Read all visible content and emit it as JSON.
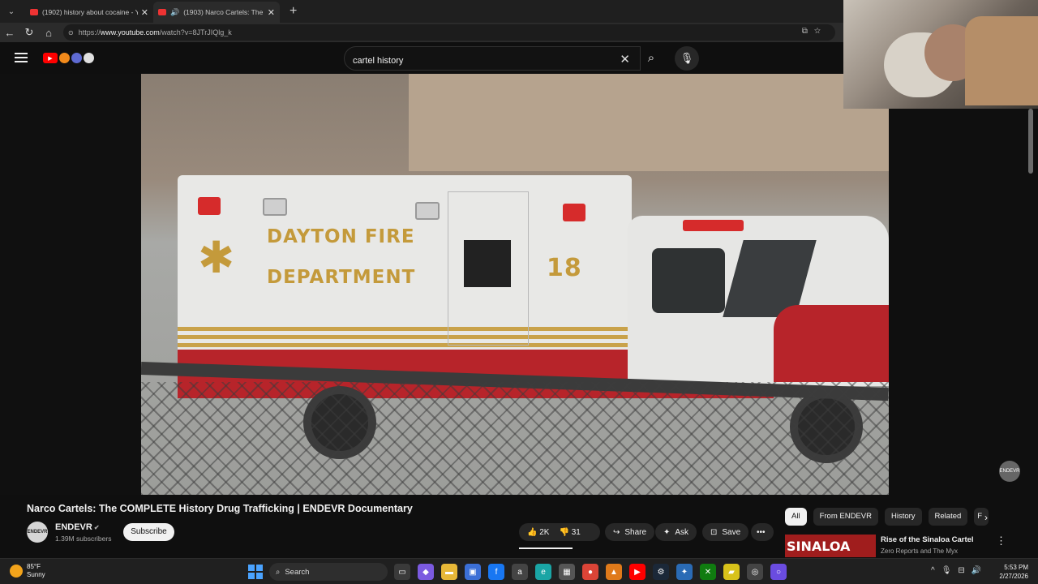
{
  "browser": {
    "tabs": [
      {
        "title": "(1902) history about cocaine - Yo",
        "active": false
      },
      {
        "title": "(1903) Narco Cartels: The CO",
        "active": true
      }
    ],
    "url_prefix": "https://",
    "url_host": "www.youtube.com",
    "url_path": "/watch?v=8JTrJIQlg_k"
  },
  "youtube": {
    "search_value": "cartel history",
    "video": {
      "title": "Narco Cartels: The COMPLETE History Drug Trafficking | ENDEVR Documentary",
      "channel_name": "ENDEVR",
      "channel_avatar_text": "ENDEVR",
      "subscribers": "1.39M subscribers",
      "subscribe_label": "Subscribe",
      "likes": "2K",
      "dislikes": "31",
      "share_label": "Share",
      "ask_label": "Ask",
      "save_label": "Save",
      "watermark": "ENDEVR",
      "frame_text_1": "DAYTON FIRE",
      "frame_text_2": "DEPARTMENT",
      "frame_text_3": "18"
    },
    "chips": [
      "All",
      "From ENDEVR",
      "History",
      "Related",
      "F"
    ],
    "recommendation": {
      "thumb_text": "SINALOA",
      "title": "Rise of the Sinaloa Cartel",
      "channel": "Zero Reports and The Myx"
    }
  },
  "taskbar": {
    "temp": "85°F",
    "condition": "Sunny",
    "search_label": "Search",
    "time": "5:53 PM",
    "date": "2/27/2026"
  },
  "colors": {
    "yt_red": "#ff0000",
    "bg": "#0f0f0f",
    "accent": "#4aa3ff"
  }
}
